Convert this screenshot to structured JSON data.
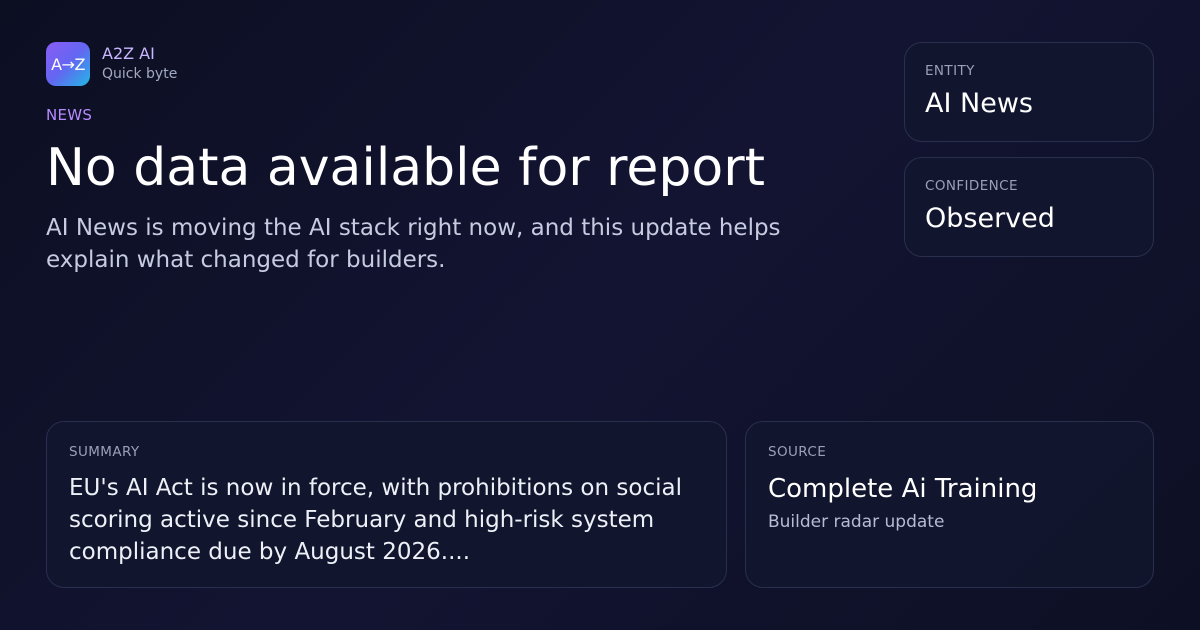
{
  "brand": {
    "logo_text": "A→Z",
    "name": "A2Z AI",
    "subtitle": "Quick byte"
  },
  "article": {
    "category": "NEWS",
    "headline": "No data available for report",
    "lede": "AI News is moving the AI stack right now, and this update helps explain what changed for builders."
  },
  "entity": {
    "label": "ENTITY",
    "value": "AI News"
  },
  "confidence": {
    "label": "CONFIDENCE",
    "value": "Observed"
  },
  "summary": {
    "label": "SUMMARY",
    "text": "EU's AI Act is now in force, with prohibitions on social scoring active since February and high-risk system compliance due by August 2026...."
  },
  "source": {
    "label": "SOURCE",
    "title": "Complete Ai Training",
    "subtitle": "Builder radar update"
  },
  "colors": {
    "accent": "#b68cff",
    "background": "#0f1128",
    "card_border": "#2a2f4e"
  }
}
